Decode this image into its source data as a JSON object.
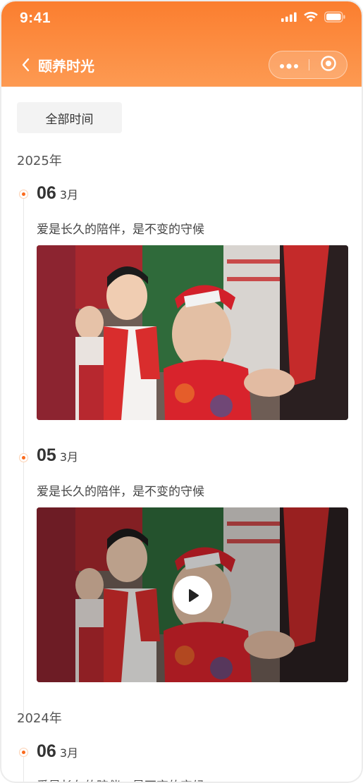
{
  "status_bar": {
    "time": "9:41"
  },
  "nav": {
    "title": "颐养时光",
    "icons": [
      "chevron-left-icon",
      "more-dots-icon",
      "target-icon"
    ]
  },
  "filter": {
    "label": "全部时间"
  },
  "colors": {
    "accent": "#fb6a1c",
    "header_top": "#fb7e2f",
    "header_bottom": "#fd9a52"
  },
  "timeline": [
    {
      "year": "2025年",
      "entries": [
        {
          "day": "06",
          "month": "3月",
          "text": "爱是长久的陪伴，是不变的守候",
          "media": "photo"
        },
        {
          "day": "05",
          "month": "3月",
          "text": "爱是长久的陪伴，是不变的守候",
          "media": "video"
        }
      ]
    },
    {
      "year": "2024年",
      "entries": [
        {
          "day": "06",
          "month": "3月",
          "text": "爱是长久的陪伴，是不变的守候",
          "media": "photo"
        }
      ]
    }
  ]
}
